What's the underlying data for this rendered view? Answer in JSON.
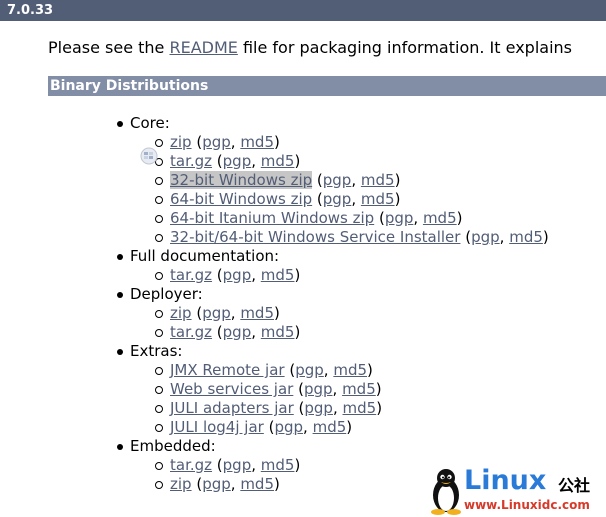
{
  "version_header": "7.0.33",
  "intro": {
    "prefix": "Please see the ",
    "link": "README",
    "suffix": " file for packaging information. It explains"
  },
  "section_title": "Binary Distributions",
  "categories": [
    {
      "label": "Core:",
      "items": [
        {
          "link": "zip",
          "pgp": "pgp",
          "md5": "md5"
        },
        {
          "link": "tar.gz",
          "pgp": "pgp",
          "md5": "md5"
        },
        {
          "link": "32-bit Windows zip",
          "pgp": "pgp",
          "md5": "md5",
          "highlighted": true
        },
        {
          "link": "64-bit Windows zip",
          "pgp": "pgp",
          "md5": "md5"
        },
        {
          "link": "64-bit Itanium Windows zip",
          "pgp": "pgp",
          "md5": "md5"
        },
        {
          "link": "32-bit/64-bit Windows Service Installer",
          "pgp": "pgp",
          "md5": "md5"
        }
      ]
    },
    {
      "label": "Full documentation:",
      "items": [
        {
          "link": "tar.gz",
          "pgp": "pgp",
          "md5": "md5"
        }
      ]
    },
    {
      "label": "Deployer:",
      "items": [
        {
          "link": "zip",
          "pgp": "pgp",
          "md5": "md5"
        },
        {
          "link": "tar.gz",
          "pgp": "pgp",
          "md5": "md5"
        }
      ]
    },
    {
      "label": "Extras:",
      "items": [
        {
          "link": "JMX Remote jar",
          "pgp": "pgp",
          "md5": "md5"
        },
        {
          "link": "Web services jar",
          "pgp": "pgp",
          "md5": "md5"
        },
        {
          "link": "JULI adapters jar",
          "pgp": "pgp",
          "md5": "md5"
        },
        {
          "link": "JULI log4j jar",
          "pgp": "pgp",
          "md5": "md5"
        }
      ]
    },
    {
      "label": "Embedded:",
      "items": [
        {
          "link": "tar.gz",
          "pgp": "pgp",
          "md5": "md5"
        },
        {
          "link": "zip",
          "pgp": "pgp",
          "md5": "md5"
        }
      ]
    }
  ],
  "watermark": {
    "brand": "Linux",
    "brand_suffix": "公社",
    "url": "www.Linuxidc.com",
    "icon": "tux-penguin-icon"
  },
  "colors": {
    "header_bg": "#525d76",
    "section_bg": "#828da6",
    "link": "#525d76",
    "highlight": "#c6c6c6"
  }
}
